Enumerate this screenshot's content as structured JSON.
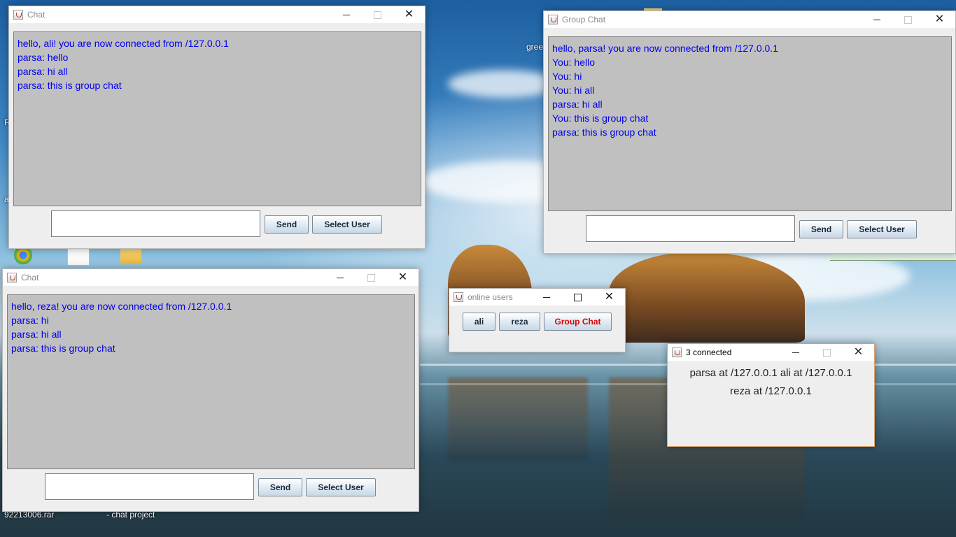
{
  "desktop": {
    "labels": {
      "green": "gree",
      "rar": "92213006.rar",
      "chat_project": "- chat project",
      "edge_r": "R",
      "edge_a": "a"
    }
  },
  "chat_ali": {
    "title": "Chat",
    "messages": [
      "hello, ali! you are now connected from /127.0.0.1",
      "parsa: hello",
      "parsa: hi all",
      "parsa: this is group chat"
    ],
    "input_value": "",
    "send_label": "Send",
    "select_user_label": "Select User"
  },
  "chat_reza": {
    "title": "Chat",
    "messages": [
      "hello, reza! you are now connected from /127.0.0.1",
      "parsa: hi",
      "parsa: hi all",
      "parsa: this is group chat"
    ],
    "input_value": "",
    "send_label": "Send",
    "select_user_label": "Select User"
  },
  "group_chat": {
    "title": "Group Chat",
    "messages": [
      "hello, parsa! you are now connected from /127.0.0.1",
      "You: hello",
      "You: hi",
      "You: hi all",
      "parsa: hi all",
      "You: this is group chat",
      "parsa: this is group chat"
    ],
    "input_value": "",
    "send_label": "Send",
    "select_user_label": "Select User"
  },
  "online_users": {
    "title": "online users",
    "buttons": [
      "ali",
      "reza",
      "Group Chat"
    ]
  },
  "connected": {
    "title": "3 connected",
    "line1": "parsa at  /127.0.0.1 ali at  /127.0.0.1",
    "line2": "reza at  /127.0.0.1"
  },
  "colors": {
    "message_text": "#0000ee",
    "chat_area_bg": "#c0c0c0",
    "group_chat_button": "#e00000"
  }
}
